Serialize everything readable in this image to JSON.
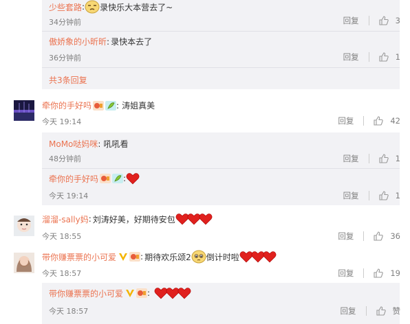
{
  "comments": [
    {
      "reply_user": "少些套路",
      "reply_sep": ":",
      "reply_text": "录快乐大本营去了~",
      "reply_time": "34分钟前",
      "reply_label": "回复",
      "reply_likes": "3"
    },
    {
      "reply_user": "傲娇象的小昕昕",
      "reply_sep": ":",
      "reply_text": "录快本去了",
      "reply_time": "36分钟前",
      "reply_label": "回复",
      "reply_likes": "1"
    }
  ],
  "more_replies": "共3条回复",
  "c1": {
    "user": "牵你的手好吗",
    "sep": ":",
    "text": "涛姐真美",
    "time": "今天 19:14",
    "reply_label": "回复",
    "likes": "42",
    "replies": [
      {
        "user": "MoMo哒妈咪",
        "sep": ":",
        "text": "吼吼看",
        "time": "48分钟前",
        "reply_label": "回复",
        "likes": "1"
      },
      {
        "user": "牵你的手好吗",
        "sep": ":",
        "text": "",
        "time": "今天 19:14",
        "reply_label": "回复",
        "likes": "1"
      }
    ]
  },
  "c2": {
    "user": "溜溜-sally妈",
    "sep": ":",
    "text": "刘涛好美，好期待安包",
    "time": "今天 18:55",
    "reply_label": "回复",
    "likes": "36"
  },
  "c3": {
    "user": "带你赚票票的小可爱",
    "sep": ":",
    "text": "期待欢乐颂2",
    "text2": "倒计时啦",
    "time": "今天 18:57",
    "reply_label": "回复",
    "likes": "19",
    "replies": [
      {
        "user": "带你赚票票的小可爱",
        "sep": ":",
        "time": "今天 18:57",
        "reply_label": "回复",
        "likes": "赞"
      }
    ]
  },
  "colors": {
    "link": "#eb7350",
    "reply_bg": "#f2f2f5",
    "heart": "#e0211e",
    "vip": "#f4b400"
  }
}
